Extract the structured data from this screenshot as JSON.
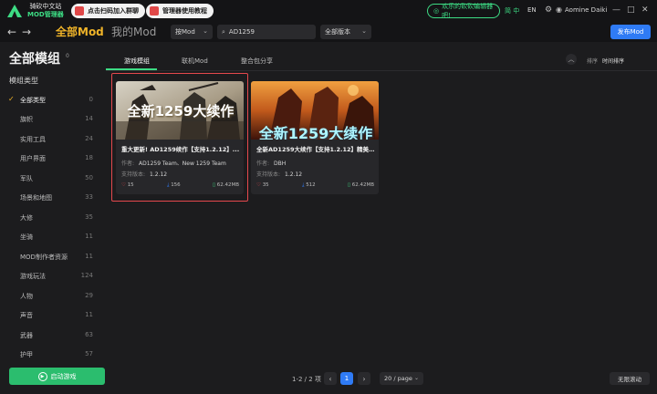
{
  "titlebar": {
    "brand_line1": "骑砍中文站",
    "brand_line2": "MOD管理器",
    "qq_group_label": "点击扫码加入群聊",
    "tutorial_label": "管理器使用教程",
    "promo_label": "欢乐的砍砍编辑器吧!",
    "lang_zh": "简 中",
    "lang_en": "EN",
    "username": "Aomine Daiki",
    "colors": {
      "accent": "#3ddc84",
      "qq_icon": "#e04848",
      "tutorial_icon": "#e04848"
    }
  },
  "navbar": {
    "all_mod": "全部Mod",
    "my_mod": "我的Mod",
    "filter_by": "按Mod",
    "search_value": "AD1259",
    "version_select": "全部版本",
    "publish_label": "发布Mod",
    "colors": {
      "all_mod": "#f0b429",
      "publish": "#2f7bf5"
    }
  },
  "sidebar": {
    "title": "全部模组",
    "title_count": "0",
    "subtitle": "模组类型",
    "categories": [
      {
        "name": "全部类型",
        "count": "0",
        "active": true
      },
      {
        "name": "旗帜",
        "count": "14"
      },
      {
        "name": "实用工具",
        "count": "24"
      },
      {
        "name": "用户界面",
        "count": "18"
      },
      {
        "name": "军队",
        "count": "50"
      },
      {
        "name": "场景和地图",
        "count": "33"
      },
      {
        "name": "大修",
        "count": "35"
      },
      {
        "name": "坐骑",
        "count": "11"
      },
      {
        "name": "MOD制作者资源",
        "count": "11"
      },
      {
        "name": "游戏玩法",
        "count": "124"
      },
      {
        "name": "人物",
        "count": "29"
      },
      {
        "name": "声音",
        "count": "11"
      },
      {
        "name": "武器",
        "count": "63"
      },
      {
        "name": "护甲",
        "count": "57"
      }
    ],
    "launch_label": "启动游戏"
  },
  "tabs": {
    "items": [
      "游戏模组",
      "联机Mod",
      "整合包分享"
    ],
    "sort_label": "排序",
    "sort_value": "时间排序"
  },
  "cards": [
    {
      "banner": "全新1259大续作",
      "title": "重大更新! AD1259续作【支持1.2.12】...",
      "author_label": "作者:",
      "author": "AD1259 Team、New 1259 Team",
      "version_label": "支持版本:",
      "version": "1.2.12",
      "likes": "15",
      "downloads": "156",
      "size": "62.42MB"
    },
    {
      "banner": "全新1259大续作",
      "title": "全新AD1259大续作【支持1.2.12】精美...",
      "author_label": "作者:",
      "author": "DBH",
      "version_label": "支持版本:",
      "version": "1.2.12",
      "likes": "35",
      "downloads": "512",
      "size": "62.42MB"
    }
  ],
  "pager": {
    "summary": "1-2 / 2 项",
    "current": "1",
    "per_page": "20 / page",
    "infinite": "无限滚动"
  }
}
